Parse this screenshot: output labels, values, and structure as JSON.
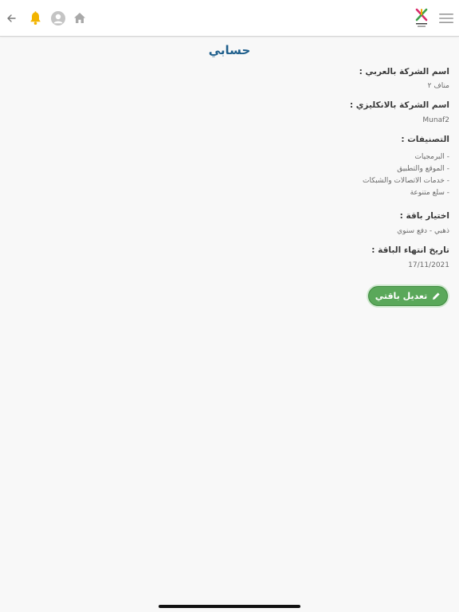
{
  "title": "حسابي",
  "fields": {
    "company_ar_label": "اسم الشركة بالعربي :",
    "company_ar_value": "مناف ٢",
    "company_en_label": "اسم الشركة بالانكليزي :",
    "company_en_value": "Munaf2",
    "categories_label": "التصنيفات :",
    "categories": [
      "- البرمجيات",
      "- الموقع والتطبيق",
      "- خدمات الاتصالات والشبكات",
      "- سلع متنوعة"
    ],
    "package_label": "اختيار باقة :",
    "package_value": "ذهبي - دفع سنوي",
    "expiry_label": "تاريخ انتهاء الباقة :",
    "expiry_value": "17/11/2021"
  },
  "edit_button_label": "تعديل باقتي",
  "icons": {
    "back": "arrow-left-icon",
    "notifications": "bell-icon",
    "profile": "avatar-icon",
    "home": "home-icon",
    "logo": "app-logo",
    "menu": "hamburger-menu-icon"
  },
  "colors": {
    "title": "#1f5f8c",
    "bell": "#f2b400",
    "button": "#5aa85a"
  }
}
